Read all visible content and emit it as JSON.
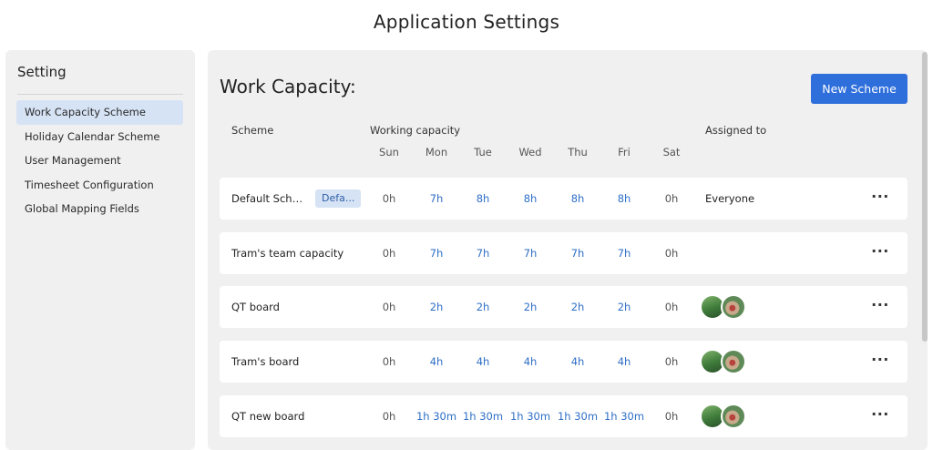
{
  "page": {
    "title": "Application Settings"
  },
  "sidebar": {
    "title": "Setting",
    "items": [
      {
        "label": "Work Capacity Scheme",
        "active": true
      },
      {
        "label": "Holiday Calendar Scheme",
        "active": false
      },
      {
        "label": "User Management",
        "active": false
      },
      {
        "label": "Timesheet Configuration",
        "active": false
      },
      {
        "label": "Global Mapping Fields",
        "active": false
      }
    ]
  },
  "main": {
    "title": "Work Capacity:",
    "new_scheme_label": "New Scheme",
    "headers": {
      "scheme": "Scheme",
      "working_capacity": "Working capacity",
      "assigned_to": "Assigned to",
      "days": [
        "Sun",
        "Mon",
        "Tue",
        "Wed",
        "Thu",
        "Fri",
        "Sat"
      ]
    },
    "rows": [
      {
        "name": "Default Sche...",
        "badge": "Defa...",
        "days": [
          "0h",
          "7h",
          "8h",
          "8h",
          "8h",
          "8h",
          "0h"
        ],
        "assigned": "Everyone",
        "avatars": 0,
        "more": "···"
      },
      {
        "name": "Tram's team capacity",
        "badge": "",
        "days": [
          "0h",
          "7h",
          "7h",
          "7h",
          "7h",
          "7h",
          "0h"
        ],
        "assigned": "",
        "avatars": 0,
        "more": "···"
      },
      {
        "name": "QT board",
        "badge": "",
        "days": [
          "0h",
          "2h",
          "2h",
          "2h",
          "2h",
          "2h",
          "0h"
        ],
        "assigned": "",
        "avatars": 2,
        "more": "···"
      },
      {
        "name": "Tram's board",
        "badge": "",
        "days": [
          "0h",
          "4h",
          "4h",
          "4h",
          "4h",
          "4h",
          "0h"
        ],
        "assigned": "",
        "avatars": 2,
        "more": "···"
      },
      {
        "name": "QT new board",
        "badge": "",
        "days": [
          "0h",
          "1h 30m",
          "1h 30m",
          "1h 30m",
          "1h 30m",
          "1h 30m",
          "0h"
        ],
        "assigned": "",
        "avatars": 2,
        "more": "···"
      }
    ]
  },
  "colors": {
    "accent": "#2f6fdb",
    "panel_bg": "#f0f0f0",
    "selected_bg": "#d6e3f5",
    "capacity_text": "#2f6fc7"
  }
}
